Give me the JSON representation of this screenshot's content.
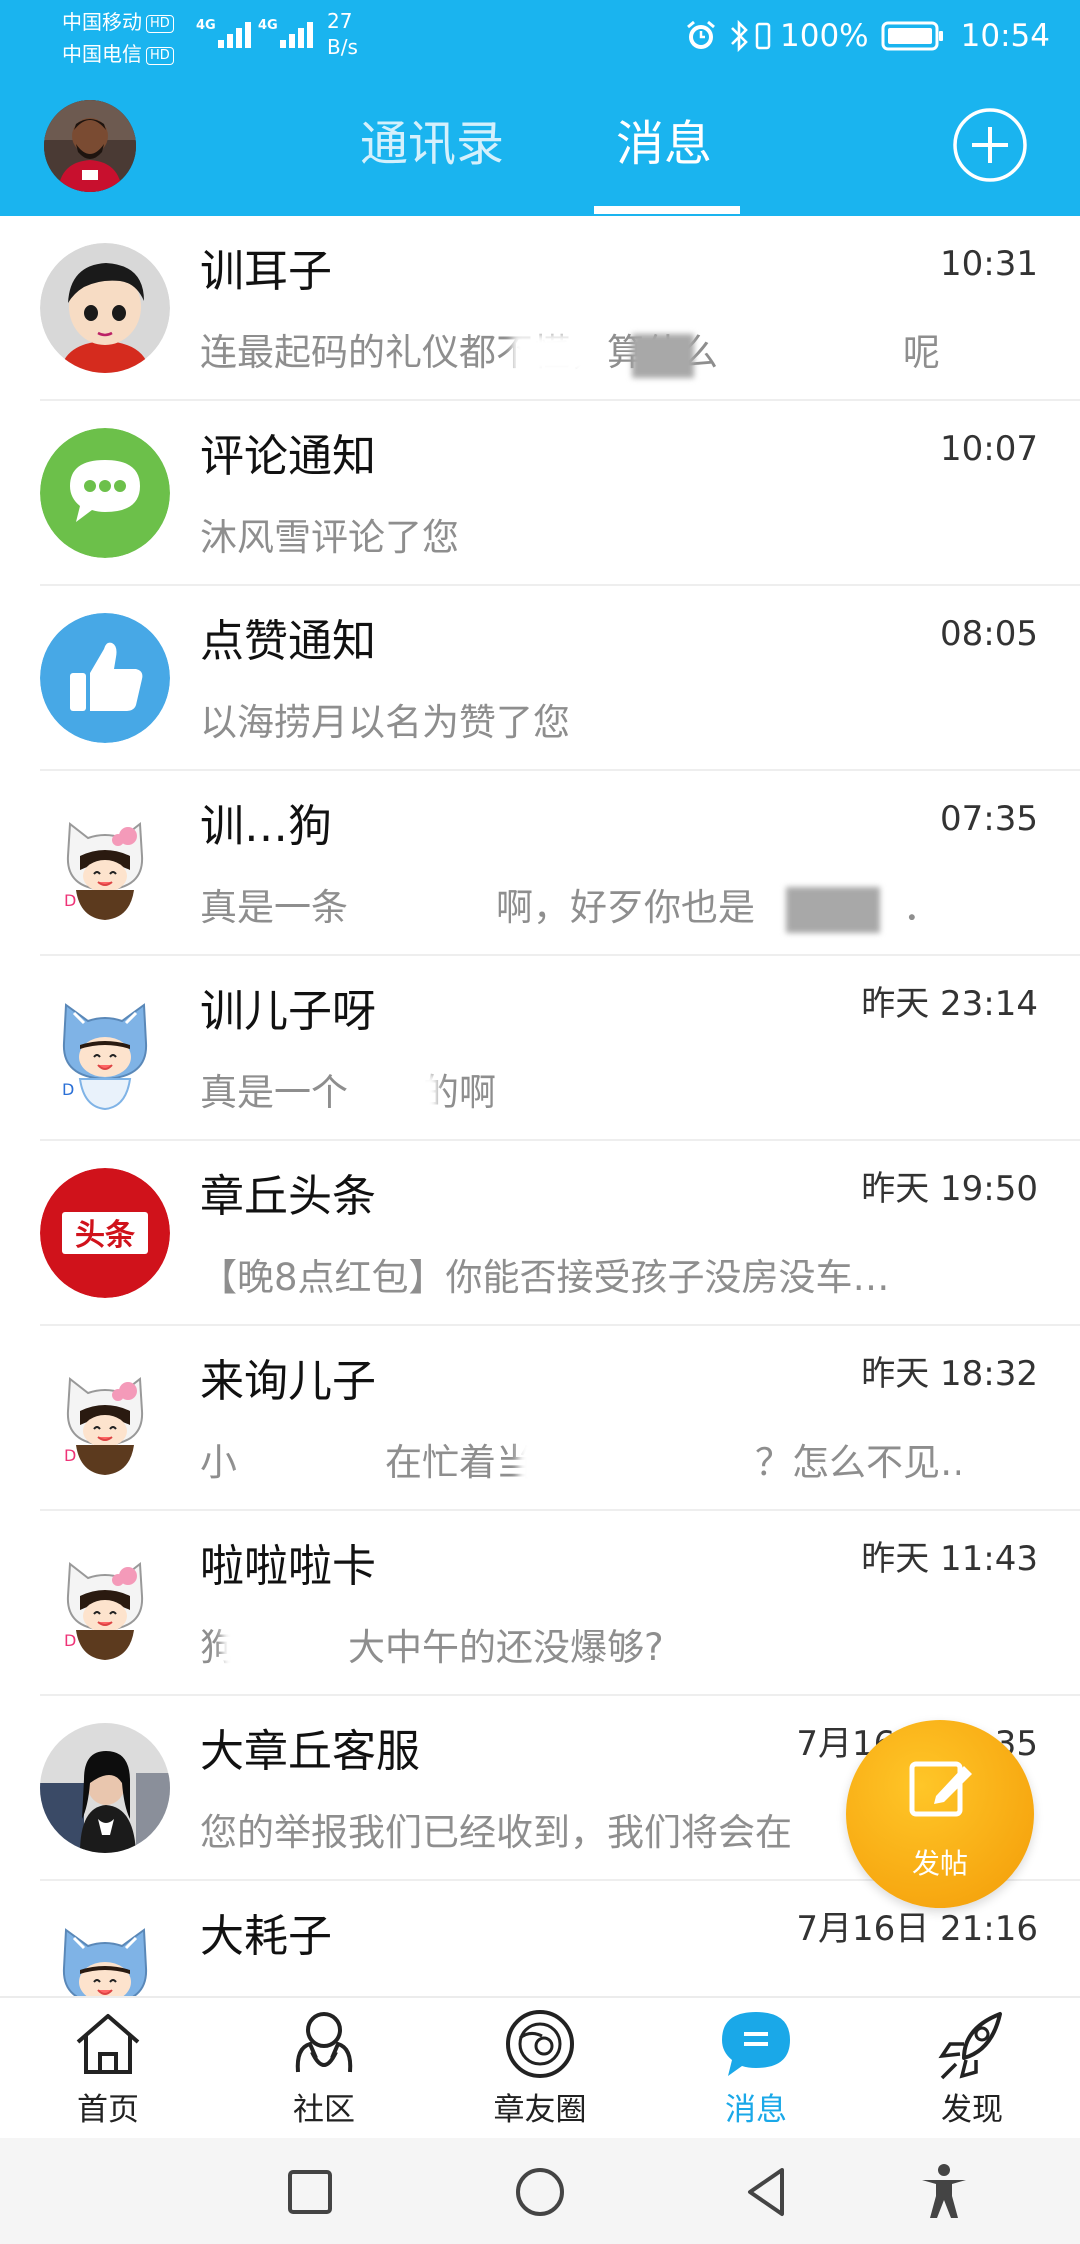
{
  "status_bar": {
    "carrier1": "中国移动",
    "carrier2": "中国电信",
    "hd": "HD",
    "network1": "4G",
    "network2": "4G",
    "speed_value": "27",
    "speed_unit": "B/s",
    "battery": "100%",
    "time": "10:54"
  },
  "header": {
    "tab_contacts": "通讯录",
    "tab_messages": "消息",
    "active_tab": "消息"
  },
  "conversations": [
    {
      "name": "训耳子",
      "time": "10:31",
      "preview": "连最起码的礼仪都不懂，算什么　　　　　呢",
      "avatar": "cartoon-boy"
    },
    {
      "name": "评论通知",
      "time": "10:07",
      "preview": "沐风雪评论了您",
      "avatar": "comment-notice"
    },
    {
      "name": "点赞通知",
      "time": "08:05",
      "preview": "以海捞月以名为赞了您",
      "avatar": "like-notice"
    },
    {
      "name": "训…狗",
      "time": "07:35",
      "preview": "真是一条　　　　啊，好歹你也是　　　　．",
      "avatar": "kitty-girl"
    },
    {
      "name": "训儿子呀",
      "time": "昨天 23:14",
      "preview": "真是一个　　的啊",
      "avatar": "blue-cat-girl"
    },
    {
      "name": "章丘头条",
      "time": "昨天 19:50",
      "preview": "【晚8点红包】你能否接受孩子没房没车…",
      "avatar": "toutiao-logo"
    },
    {
      "name": "来询儿子",
      "time": "昨天 18:32",
      "preview": "小　　　　在忙着当　　　　　　？怎么不见…",
      "avatar": "kitty-girl"
    },
    {
      "name": "啦啦啦卡",
      "time": "昨天 11:43",
      "preview": "狗　　　大中午的还没爆够?",
      "avatar": "kitty-girl"
    },
    {
      "name": "大章丘客服",
      "time": "7月16日 21:35",
      "preview": "您的举报我们已经收到，我们将会在　　　",
      "avatar": "photo-woman"
    },
    {
      "name": "大耗子",
      "time": "7月16日 21:16",
      "preview": "",
      "avatar": "blue-cat-girl"
    }
  ],
  "fab": {
    "label": "发帖"
  },
  "bottom_nav": [
    {
      "label": "首页",
      "icon": "home-icon"
    },
    {
      "label": "社区",
      "icon": "community-icon"
    },
    {
      "label": "章友圈",
      "icon": "friends-circle-icon"
    },
    {
      "label": "消息",
      "icon": "messages-icon",
      "active": true
    },
    {
      "label": "发现",
      "icon": "rocket-icon"
    }
  ],
  "colors": {
    "header_blue": "#1ab4ef",
    "active_nav": "#1aa8e8",
    "fab_orange": "#f7a811",
    "comment_green": "#6cc04a",
    "like_blue": "#47a8e6",
    "toutiao_red": "#d0121b"
  }
}
